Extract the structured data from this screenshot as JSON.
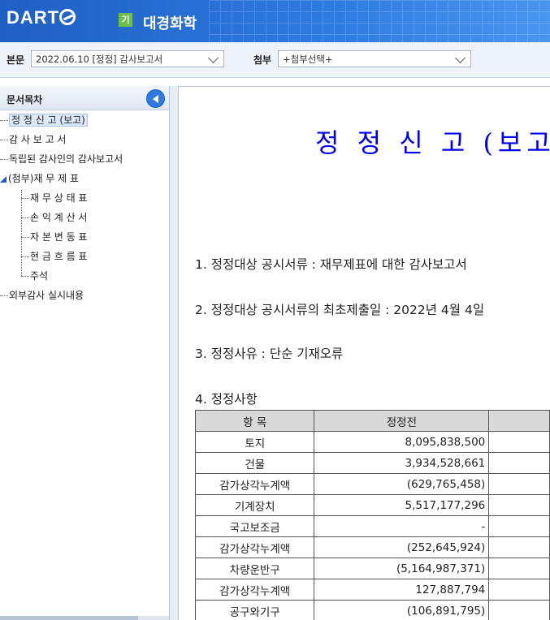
{
  "header": {
    "logo": "DART",
    "badge": "기",
    "company": "대경화학",
    "colors": {
      "primary": "#1f5fc4",
      "accent": "#6cc04a"
    }
  },
  "toolbar": {
    "main_label": "본문",
    "main_select": "2022.06.10  [정정] 감사보고서",
    "attach_label": "첨부",
    "attach_select": "+첨부선택+"
  },
  "sidebar": {
    "title": "문서목차",
    "items": [
      {
        "label": "정 정 신 고 (보고)",
        "selected": true
      },
      {
        "label": "감 사 보 고 서"
      },
      {
        "label": "독립된 감사인의 감사보고서"
      },
      {
        "label": "(첨부)재 무 제 표",
        "expanded": true
      },
      {
        "label": "재 무 상 태 표"
      },
      {
        "label": "손 익 계 산 서"
      },
      {
        "label": "자 본 변 동 표"
      },
      {
        "label": "현 금 흐 름 표"
      },
      {
        "label": "주석"
      },
      {
        "label": "외부감사 실시내용"
      }
    ]
  },
  "document": {
    "title": "정 정 신 고 (보고",
    "paragraphs": [
      "1. 정정대상 공시서류 : 재무제표에 대한 감사보고서",
      "2. 정정대상 공시서류의 최초제출일 : 2022년 4월 4일",
      "3. 정정사유 : 단순 기재오류",
      "4. 정정사항"
    ],
    "table": {
      "headers": [
        "항 목",
        "정정전",
        ""
      ],
      "rows": [
        [
          "토지",
          "8,095,838,500"
        ],
        [
          "건물",
          "3,934,528,661"
        ],
        [
          "감가상각누계액",
          "(629,765,458)"
        ],
        [
          "기계장치",
          "5,517,177,296"
        ],
        [
          "국고보조금",
          "-"
        ],
        [
          "감가상각누계액",
          "(252,645,924)"
        ],
        [
          "차량운반구",
          "(5,164,987,371)"
        ],
        [
          "감가상각누계액",
          "127,887,794"
        ],
        [
          "공구와기구",
          "(106,891,795)"
        ]
      ]
    }
  }
}
